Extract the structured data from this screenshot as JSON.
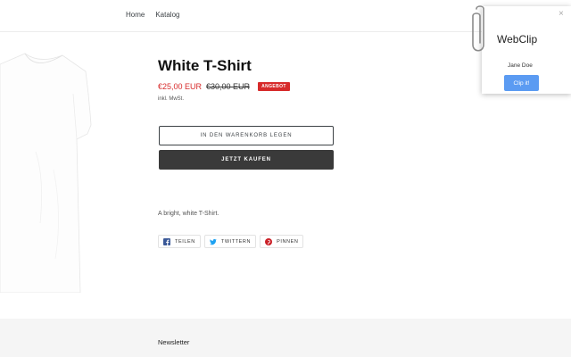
{
  "nav": {
    "items": [
      "Home",
      "Katalog"
    ]
  },
  "product": {
    "title": "White T-Shirt",
    "price_sale": "€25,00 EUR",
    "price_compare": "€30,00 EUR",
    "sale_badge": "ANGEBOT",
    "tax_note": "inkl. MwSt.",
    "add_to_cart": "IN DEN WARENKORB LEGEN",
    "buy_now": "JETZT KAUFEN",
    "description": "A bright, white T-Shirt."
  },
  "share": [
    {
      "label": "TEILEN",
      "icon": "facebook-icon",
      "color": "#3b5998"
    },
    {
      "label": "TWITTERN",
      "icon": "twitter-icon",
      "color": "#1da1f2"
    },
    {
      "label": "PINNEN",
      "icon": "pinterest-icon",
      "color": "#cb2027"
    }
  ],
  "footer": {
    "newsletter": "Newsletter"
  },
  "webclip": {
    "title": "WebClip",
    "user": "Jane Doe",
    "clip_button": "Clip it!",
    "close": "×",
    "accent": "#5b9bf2"
  },
  "colors": {
    "sale": "#d72b2b",
    "buy_button": "#3a3a3a"
  }
}
